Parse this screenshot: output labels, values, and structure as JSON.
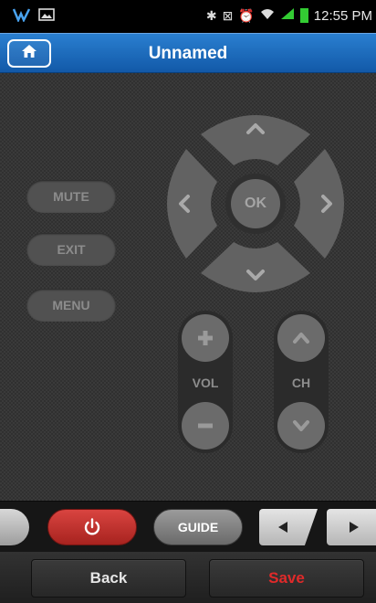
{
  "status_bar": {
    "time": "12:55 PM",
    "left_icons": [
      "carrier-icon",
      "image-icon"
    ],
    "right_icons": [
      "bluetooth-icon",
      "nfc-icon",
      "alarm-icon",
      "wifi-icon",
      "signal-icon",
      "battery-icon"
    ]
  },
  "header": {
    "title": "Unnamed",
    "home_icon": "home-icon"
  },
  "remote": {
    "side_buttons": [
      "MUTE",
      "EXIT",
      "MENU"
    ],
    "dpad": {
      "center": "OK",
      "up_icon": "chevron-up-icon",
      "down_icon": "chevron-down-icon",
      "left_icon": "chevron-left-icon",
      "right_icon": "chevron-right-icon"
    },
    "volume": {
      "label": "VOL"
    },
    "channel": {
      "label": "CH"
    }
  },
  "bottom_strip": {
    "guide_label": "GUIDE"
  },
  "actions": {
    "back_label": "Back",
    "save_label": "Save"
  },
  "colors": {
    "accent_blue": "#1c6ec2",
    "power_red": "#c0302c",
    "save_red": "#e02a2a"
  }
}
